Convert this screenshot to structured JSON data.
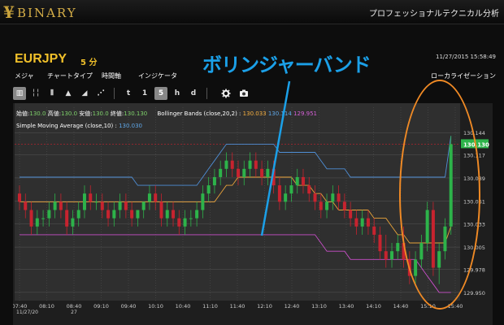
{
  "header": {
    "logo_text": "BINARY",
    "tagline": "プロフェッショナルテクニカル分析"
  },
  "instrument": {
    "symbol": "EURJPY",
    "interval": "5 分",
    "datetime": "11/27/2015 15:58:49"
  },
  "callout": "ボリンジャーバンド",
  "menu": {
    "items": [
      "メジャ",
      "チャートタイプ",
      "時間軸",
      "インジケータ"
    ],
    "right": "ローカライゼーション"
  },
  "toolbar": {
    "items": [
      {
        "label": "▥",
        "active": true
      },
      {
        "label": "╎╎",
        "active": false
      },
      {
        "label": "⦀",
        "active": false
      },
      {
        "label": "▲",
        "active": false
      },
      {
        "label": "◢",
        "active": false
      },
      {
        "label": "⋰",
        "active": false
      },
      {
        "label": "t",
        "active": false
      },
      {
        "label": "1",
        "active": false
      },
      {
        "label": "5",
        "active": true
      },
      {
        "label": "h",
        "active": false
      },
      {
        "label": "d",
        "active": false
      }
    ]
  },
  "ohlc_header": {
    "open_label": "始値:",
    "open_value": "130.0",
    "high_label": "高値:",
    "high_value": "130.0",
    "low_label": "安値:",
    "low_value": "130.0",
    "close_label": "終値:",
    "close_value": "130.130",
    "bb_label": "Bollinger Bands (close,20,2) :",
    "bb_mid": "130.033",
    "bb_upper": "130.114",
    "bb_lower": "129.951"
  },
  "sma_header": {
    "label": "Simple Moving Average (close,10) :",
    "value": "130.030"
  },
  "colors": {
    "bg": "#2f2f2f",
    "grid": "#555555",
    "candle_up": "#2db34a",
    "candle_down": "#c7232f",
    "bb_upper_line": "#4f8fd6",
    "bb_lower_line": "#c94fc9",
    "sma_line": "#e9a33a",
    "price_badge": "#2db34a",
    "callout": "#1ba0e8",
    "highlight": "#f08a25"
  },
  "chart_data": {
    "type": "candlestick",
    "y_ticks": [
      "130.144",
      "130.117",
      "130.089",
      "130.061",
      "130.033",
      "130.005",
      "129.978",
      "129.950"
    ],
    "x_ticks": [
      "07:40",
      "08:10",
      "08:40",
      "09:10",
      "09:40",
      "10:10",
      "10:40",
      "11:10",
      "11:40",
      "12:10",
      "12:40",
      "13:10",
      "13:40",
      "14:10",
      "14:40",
      "15:10",
      "15:40"
    ],
    "x_subticks": [
      "11/27/20",
      "27"
    ],
    "last_price": "130.130",
    "ylim": [
      129.94,
      130.16
    ],
    "candles": [
      [
        130.07,
        130.08,
        130.05,
        130.06
      ],
      [
        130.06,
        130.07,
        130.04,
        130.05
      ],
      [
        130.05,
        130.06,
        130.02,
        130.03
      ],
      [
        130.03,
        130.05,
        130.02,
        130.04
      ],
      [
        130.04,
        130.05,
        130.03,
        130.04
      ],
      [
        130.04,
        130.06,
        130.03,
        130.05
      ],
      [
        130.05,
        130.07,
        130.04,
        130.06
      ],
      [
        130.06,
        130.07,
        130.04,
        130.05
      ],
      [
        130.05,
        130.06,
        130.02,
        130.03
      ],
      [
        130.03,
        130.05,
        130.02,
        130.04
      ],
      [
        130.04,
        130.06,
        130.03,
        130.05
      ],
      [
        130.05,
        130.08,
        130.04,
        130.07
      ],
      [
        130.07,
        130.08,
        130.05,
        130.06
      ],
      [
        130.06,
        130.07,
        130.05,
        130.06
      ],
      [
        130.06,
        130.07,
        130.04,
        130.05
      ],
      [
        130.05,
        130.06,
        130.03,
        130.04
      ],
      [
        130.04,
        130.06,
        130.03,
        130.05
      ],
      [
        130.05,
        130.07,
        130.04,
        130.06
      ],
      [
        130.06,
        130.07,
        130.04,
        130.05
      ],
      [
        130.05,
        130.06,
        130.03,
        130.04
      ],
      [
        130.04,
        130.05,
        130.03,
        130.05
      ],
      [
        130.05,
        130.06,
        130.04,
        130.06
      ],
      [
        130.06,
        130.08,
        130.05,
        130.07
      ],
      [
        130.07,
        130.08,
        130.05,
        130.06
      ],
      [
        130.06,
        130.07,
        130.03,
        130.04
      ],
      [
        130.04,
        130.06,
        130.03,
        130.05
      ],
      [
        130.05,
        130.06,
        130.03,
        130.04
      ],
      [
        130.04,
        130.05,
        130.02,
        130.03
      ],
      [
        130.03,
        130.05,
        130.02,
        130.04
      ],
      [
        130.04,
        130.05,
        130.03,
        130.04
      ],
      [
        130.04,
        130.06,
        130.03,
        130.05
      ],
      [
        130.05,
        130.08,
        130.04,
        130.07
      ],
      [
        130.07,
        130.09,
        130.06,
        130.08
      ],
      [
        130.08,
        130.1,
        130.07,
        130.09
      ],
      [
        130.09,
        130.11,
        130.08,
        130.1
      ],
      [
        130.1,
        130.12,
        130.09,
        130.11
      ],
      [
        130.11,
        130.12,
        130.09,
        130.1
      ],
      [
        130.1,
        130.11,
        130.08,
        130.09
      ],
      [
        130.09,
        130.11,
        130.08,
        130.1
      ],
      [
        130.1,
        130.12,
        130.09,
        130.11
      ],
      [
        130.11,
        130.12,
        130.09,
        130.1
      ],
      [
        130.1,
        130.11,
        130.08,
        130.09
      ],
      [
        130.09,
        130.11,
        130.08,
        130.1
      ],
      [
        130.1,
        130.11,
        130.07,
        130.08
      ],
      [
        130.08,
        130.09,
        130.05,
        130.06
      ],
      [
        130.06,
        130.08,
        130.05,
        130.07
      ],
      [
        130.07,
        130.09,
        130.06,
        130.08
      ],
      [
        130.08,
        130.1,
        130.07,
        130.09
      ],
      [
        130.09,
        130.1,
        130.07,
        130.08
      ],
      [
        130.08,
        130.09,
        130.06,
        130.07
      ],
      [
        130.07,
        130.08,
        130.05,
        130.06
      ],
      [
        130.06,
        130.07,
        130.04,
        130.05
      ],
      [
        130.05,
        130.07,
        130.04,
        130.06
      ],
      [
        130.06,
        130.08,
        130.05,
        130.07
      ],
      [
        130.07,
        130.08,
        130.05,
        130.06
      ],
      [
        130.06,
        130.07,
        130.04,
        130.05
      ],
      [
        130.05,
        130.06,
        130.03,
        130.04
      ],
      [
        130.04,
        130.05,
        130.02,
        130.03
      ],
      [
        130.03,
        130.05,
        130.02,
        130.04
      ],
      [
        130.04,
        130.05,
        130.02,
        130.03
      ],
      [
        130.03,
        130.04,
        130.01,
        130.02
      ],
      [
        130.02,
        130.03,
        129.99,
        130.0
      ],
      [
        130.0,
        130.02,
        129.98,
        129.99
      ],
      [
        129.99,
        130.01,
        129.98,
        130.0
      ],
      [
        130.0,
        130.02,
        129.99,
        130.01
      ],
      [
        130.01,
        130.03,
        129.98,
        129.99
      ],
      [
        129.99,
        130.0,
        129.96,
        129.97
      ],
      [
        129.97,
        130.0,
        129.96,
        129.99
      ],
      [
        129.99,
        130.02,
        129.98,
        130.01
      ],
      [
        130.01,
        130.06,
        130.0,
        130.05
      ],
      [
        130.05,
        130.06,
        129.97,
        129.98
      ],
      [
        129.98,
        130.01,
        129.96,
        130.0
      ],
      [
        130.0,
        130.04,
        129.99,
        130.03
      ],
      [
        130.03,
        130.14,
        130.02,
        130.13
      ]
    ],
    "bb_upper": [
      130.09,
      130.09,
      130.09,
      130.09,
      130.09,
      130.09,
      130.09,
      130.09,
      130.09,
      130.09,
      130.09,
      130.09,
      130.09,
      130.09,
      130.09,
      130.09,
      130.09,
      130.09,
      130.09,
      130.09,
      130.08,
      130.08,
      130.08,
      130.08,
      130.08,
      130.08,
      130.08,
      130.08,
      130.08,
      130.08,
      130.08,
      130.09,
      130.1,
      130.11,
      130.12,
      130.13,
      130.13,
      130.13,
      130.13,
      130.13,
      130.13,
      130.13,
      130.13,
      130.13,
      130.12,
      130.12,
      130.12,
      130.12,
      130.12,
      130.12,
      130.12,
      130.11,
      130.1,
      130.1,
      130.1,
      130.1,
      130.09,
      130.09,
      130.09,
      130.09,
      130.09,
      130.09,
      130.09,
      130.09,
      130.09,
      130.09,
      130.09,
      130.09,
      130.09,
      130.09,
      130.09,
      130.09,
      130.09,
      130.14
    ],
    "bb_lower": [
      130.02,
      130.02,
      130.02,
      130.02,
      130.02,
      130.02,
      130.02,
      130.02,
      130.02,
      130.02,
      130.02,
      130.02,
      130.02,
      130.02,
      130.02,
      130.02,
      130.02,
      130.02,
      130.02,
      130.02,
      130.02,
      130.02,
      130.02,
      130.02,
      130.02,
      130.02,
      130.02,
      130.02,
      130.02,
      130.02,
      130.02,
      130.02,
      130.02,
      130.02,
      130.02,
      130.02,
      130.02,
      130.02,
      130.02,
      130.02,
      130.02,
      130.02,
      130.02,
      130.02,
      130.02,
      130.02,
      130.02,
      130.02,
      130.02,
      130.02,
      130.02,
      130.01,
      130.0,
      130.0,
      130.0,
      130.0,
      129.99,
      129.99,
      129.99,
      129.99,
      129.99,
      129.99,
      129.99,
      129.99,
      129.99,
      129.99,
      129.99,
      129.99,
      129.98,
      129.97,
      129.96,
      129.95,
      129.95,
      129.95
    ],
    "sma": [
      130.06,
      130.06,
      130.06,
      130.06,
      130.06,
      130.06,
      130.06,
      130.06,
      130.06,
      130.06,
      130.06,
      130.06,
      130.06,
      130.06,
      130.06,
      130.06,
      130.06,
      130.06,
      130.06,
      130.06,
      130.06,
      130.06,
      130.06,
      130.06,
      130.06,
      130.06,
      130.06,
      130.06,
      130.06,
      130.06,
      130.06,
      130.06,
      130.06,
      130.06,
      130.07,
      130.08,
      130.08,
      130.09,
      130.09,
      130.09,
      130.09,
      130.09,
      130.09,
      130.09,
      130.09,
      130.09,
      130.09,
      130.08,
      130.08,
      130.08,
      130.07,
      130.07,
      130.06,
      130.06,
      130.05,
      130.05,
      130.05,
      130.05,
      130.05,
      130.05,
      130.04,
      130.04,
      130.04,
      130.03,
      130.02,
      130.02,
      130.01,
      130.01,
      130.01,
      130.01,
      130.01,
      130.01,
      130.01,
      130.03
    ]
  }
}
